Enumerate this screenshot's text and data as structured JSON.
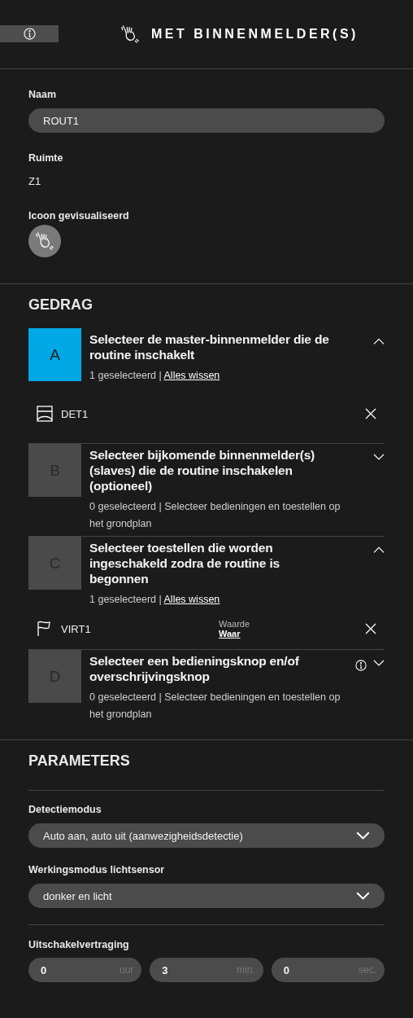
{
  "header": {
    "info_button": true,
    "title": "MET BINNENMELDER(S)"
  },
  "general": {
    "name_label": "Naam",
    "name_value": "ROUT1",
    "room_label": "Ruimte",
    "room_value": "Z1",
    "icon_label": "Icoon gevisualiseerd"
  },
  "behaviour": {
    "title": "GEDRAG",
    "steps": [
      {
        "letter": "A",
        "active": true,
        "expanded": true,
        "info": false,
        "title": "Selecteer de master-binnenmelder die de routine inschakelt",
        "count": "1 geselecteerd | ",
        "action": {
          "kind": "link",
          "text": "Alles wissen"
        },
        "items": [
          {
            "kind": "detector",
            "name": "DET1"
          }
        ]
      },
      {
        "letter": "B",
        "active": false,
        "expanded": false,
        "info": false,
        "title": "Selecteer bijkomende binnenmelder(s) (slaves) die de routine inschakelen (optioneel)",
        "count": "0 geselecteerd | ",
        "action": {
          "kind": "hint",
          "text": "Selecteer bedieningen en toestellen op het grondplan"
        }
      },
      {
        "letter": "C",
        "active": false,
        "expanded": true,
        "info": false,
        "title": "Selecteer toestellen die worden ingeschakeld zodra de routine is begonnen",
        "count": "1 geselecteerd | ",
        "action": {
          "kind": "link",
          "text": "Alles wissen"
        },
        "items": [
          {
            "kind": "flag",
            "name": "VIRT1",
            "value_label": "Waarde",
            "value": "Waar"
          }
        ]
      },
      {
        "letter": "D",
        "active": false,
        "expanded": false,
        "info": true,
        "title": "Selecteer een bedieningsknop en/of overschrijvingsknop",
        "count": "0 geselecteerd | ",
        "action": {
          "kind": "hint",
          "text": "Selecteer bedieningen en toestellen op het grondplan"
        }
      }
    ]
  },
  "parameters": {
    "title": "PARAMETERS",
    "selects": [
      {
        "label": "Detectiemodus",
        "value": "Auto aan, auto uit (aanwezigheidsdetectie)"
      },
      {
        "label": "Werkingsmodus lichtsensor",
        "value": "donker en licht"
      }
    ],
    "delay": {
      "label": "Uitschakelvertraging",
      "fields": [
        {
          "value": "0",
          "unit": "uur"
        },
        {
          "value": "3",
          "unit": "min."
        },
        {
          "value": "0",
          "unit": "sec."
        }
      ]
    }
  }
}
